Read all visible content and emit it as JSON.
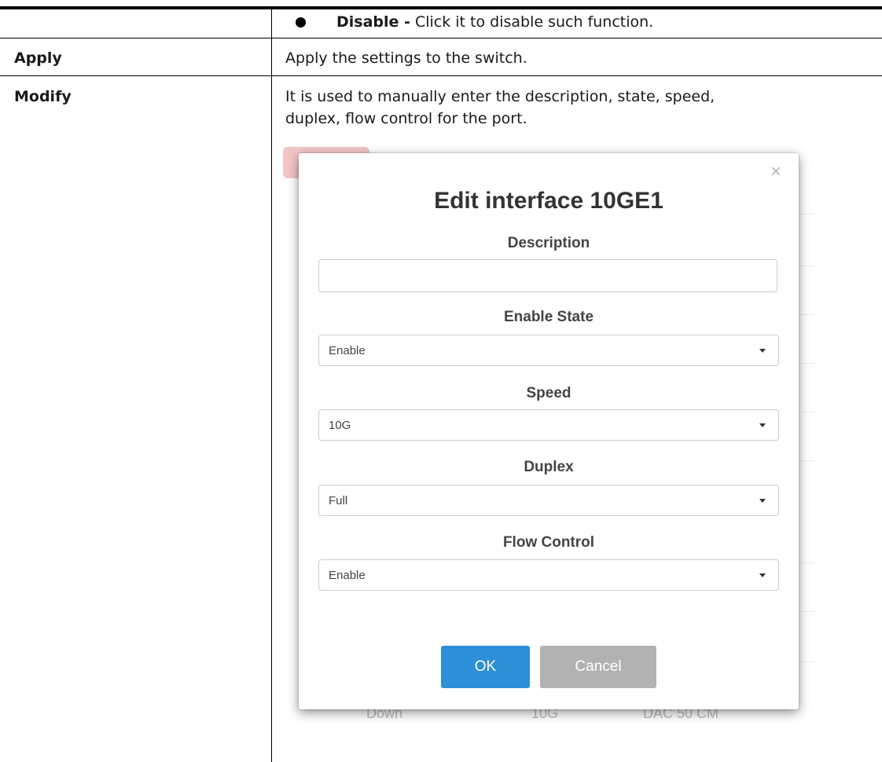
{
  "rows": [
    {
      "bullet_term": "Disable -",
      "bullet_text": " Click it to disable such function."
    },
    {
      "term": "Apply",
      "description": "Apply the settings to the switch."
    },
    {
      "term": "Modify",
      "description_line1": "It is used to manually enter the description, state, speed,",
      "description_line2": "duplex, flow control for the port."
    }
  ],
  "dialog": {
    "title": "Edit interface 10GE1",
    "close_glyph": "×",
    "description_label": "Description",
    "description_value": "",
    "enable_state_label": "Enable State",
    "enable_state_value": "Enable",
    "speed_label": "Speed",
    "speed_value": "10G",
    "duplex_label": "Duplex",
    "duplex_value": "Full",
    "flow_control_label": "Flow Control",
    "flow_control_value": "Enable",
    "ok_label": "OK",
    "cancel_label": "Cancel"
  },
  "background_table": {
    "partial_cells": [
      "Down",
      "10G",
      "DAC 50 CM"
    ]
  },
  "colors": {
    "ok_button": "#2d8fd8",
    "cancel_button": "#b2b2b2"
  }
}
